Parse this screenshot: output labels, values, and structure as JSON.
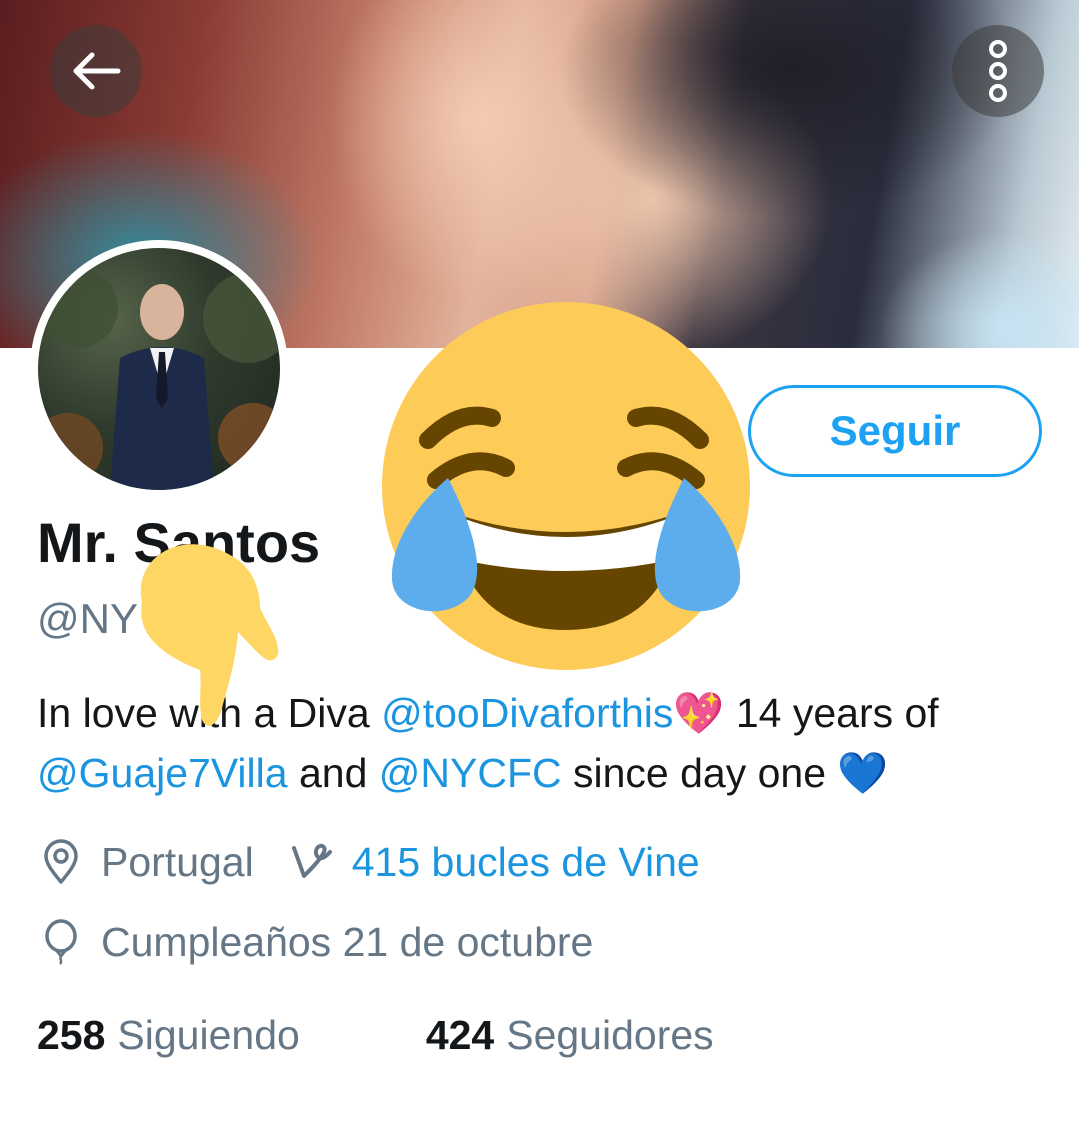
{
  "profile": {
    "display_name": "Mr. Santos",
    "handle": "@NY        e 07",
    "follow_label": "Seguir"
  },
  "bio": {
    "text_before": "In love with a Diva ",
    "mention_1": "@tooDivaforthis",
    "emoji_heart": "💖",
    "text_middle": " 14 years of",
    "mention_2": "@Guaje7Villa",
    "text_and": " and ",
    "mention_3": "@NYCFC",
    "text_end": " since day one ",
    "emoji_blue_heart": "💙"
  },
  "meta": {
    "location": "Portugal",
    "vine_loops": "415 bucles de Vine",
    "birthday": "Cumpleaños 21 de octubre"
  },
  "stats": {
    "following_count": "258",
    "following_label": "Siguiendo",
    "followers_count": "424",
    "followers_label": "Seguidores"
  },
  "icons": {
    "back": "arrow-left-icon",
    "more": "vertical-dots-icon",
    "location": "map-pin-icon",
    "vine": "vine-logo-icon",
    "birthday": "balloon-icon"
  },
  "colors": {
    "accent": "#1da1f2",
    "link": "#1b95e0",
    "secondary_text": "#657786",
    "primary_text": "#14171a"
  }
}
